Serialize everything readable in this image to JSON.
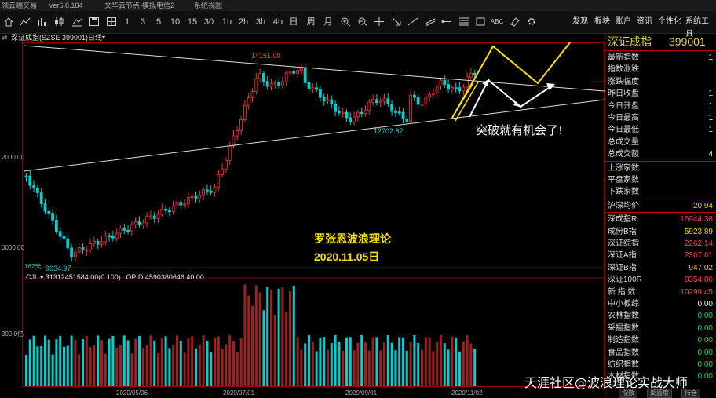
{
  "titlebar": {
    "app": "领云端交易",
    "version": "Ver6.8.184",
    "broker": "文华云节点-模拟电信2",
    "menu": "系统视图"
  },
  "toolbar": {
    "periods": [
      "1",
      "3",
      "5",
      "10",
      "15",
      "30",
      "1h",
      "2h",
      "3h",
      "4h",
      "日",
      "周",
      "月"
    ],
    "right_menu": [
      "发现",
      "板块",
      "账户",
      "资讯",
      "个性化",
      "系统工具"
    ],
    "abc_label": "ABC"
  },
  "chart_header": {
    "name": "深证成指(SZSE 399001)",
    "period": "日线"
  },
  "price_labels": {
    "high": "14151.00",
    "mid_low": "12702.62",
    "low": "9634.97",
    "days": "162天",
    "axis_2000": "2000.00",
    "axis_0000": "0000.00",
    "vol_axis": "390.0亿"
  },
  "volume_header": {
    "name": "CJL",
    "value": "31312451584.00(0:100)",
    "opid": "OPID 4590380646 40.00"
  },
  "dates": [
    "2020/05/06",
    "2020/07/01",
    "2020/09/01",
    "2020/11/02"
  ],
  "annotations": {
    "title": "罗张恩波浪理论",
    "date": "2020.11.05日",
    "breakout": "突破就有机会了!"
  },
  "watermark": "天涯社区@波浪理论实战大师",
  "panel": {
    "title": "深证成指",
    "code": "399001",
    "rows1": [
      {
        "label": "最新指数",
        "value": "1"
      },
      {
        "label": "指数涨跌",
        "value": ""
      },
      {
        "label": "涨跌幅度",
        "value": ""
      },
      {
        "label": "昨日收盘",
        "value": "1"
      },
      {
        "label": "今日开盘",
        "value": "1"
      },
      {
        "label": "今日最高",
        "value": "1"
      },
      {
        "label": "今日最低",
        "value": "1"
      },
      {
        "label": "总成交量",
        "value": ""
      },
      {
        "label": "总成交额",
        "value": "4"
      }
    ],
    "rows2": [
      {
        "label": "上涨家数",
        "value": ""
      },
      {
        "label": "平盘家数",
        "value": ""
      },
      {
        "label": "下跌家数",
        "value": ""
      }
    ],
    "hushen": {
      "label": "沪深均价",
      "value": "20.94"
    },
    "rows3": [
      {
        "label": "深成指R",
        "value": "16944.38",
        "cls": "red"
      },
      {
        "label": "成份B指",
        "value": "5923.89",
        "cls": "yel"
      },
      {
        "label": "深证综指",
        "value": "2262.14",
        "cls": "red"
      },
      {
        "label": "深证A指",
        "value": "2367.61",
        "cls": "red"
      },
      {
        "label": "深证B指",
        "value": "947.02",
        "cls": "yel"
      },
      {
        "label": "深证100R",
        "value": "8354.86",
        "cls": "red"
      },
      {
        "label": "新 指 数",
        "value": "10299.45",
        "cls": "red"
      },
      {
        "label": "中小板综",
        "value": "0.00",
        "cls": "wht"
      },
      {
        "label": "农林指数",
        "value": "0.00",
        "cls": "grn"
      },
      {
        "label": "采掘指数",
        "value": "0.00",
        "cls": "grn"
      },
      {
        "label": "制造指数",
        "value": "0.00",
        "cls": "grn"
      },
      {
        "label": "食品指数",
        "value": "0.00",
        "cls": "grn"
      },
      {
        "label": "纺织指数",
        "value": "0.00",
        "cls": "grn"
      },
      {
        "label": "木材指数",
        "value": "0.00",
        "cls": "grn"
      }
    ],
    "tabs": [
      "指数",
      "反面度",
      "持仓"
    ]
  },
  "colors": {
    "up": "#ff3030",
    "down": "#00d0d0",
    "accent": "#e8d33a",
    "arrow_yellow": "#ffe000"
  },
  "chart_data": {
    "type": "candlestick",
    "notes": "Daily candles of Shenzhen Component Index, approximate",
    "highs_labels": [
      "14151.00"
    ],
    "lows_labels": [
      "12702.62",
      "9634.97"
    ]
  }
}
